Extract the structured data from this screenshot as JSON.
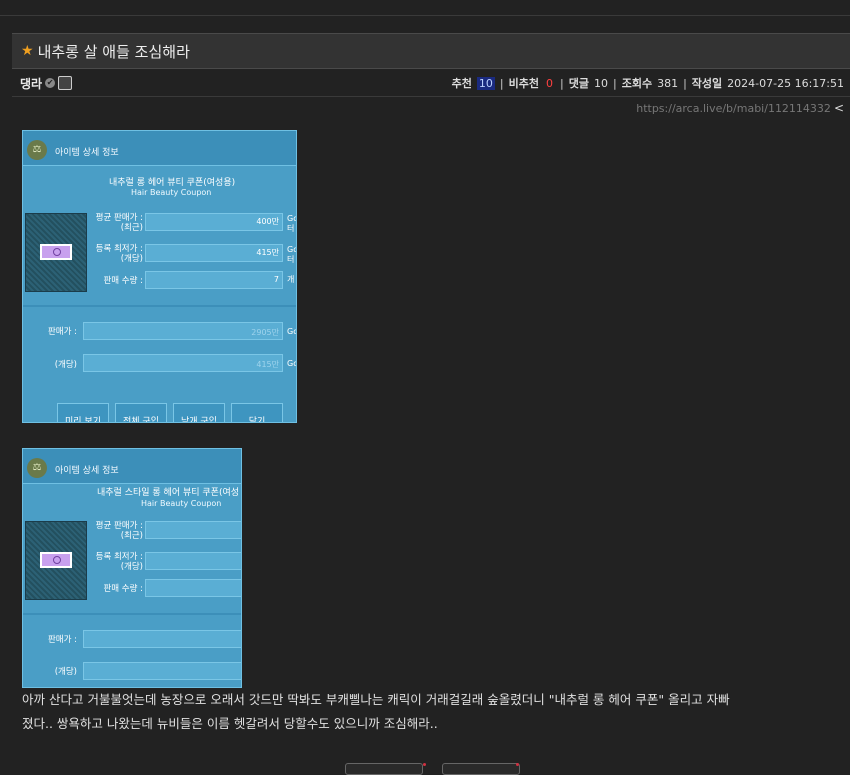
{
  "post": {
    "title": "내추롱 살 애들 조심해라",
    "author": "댕라",
    "stats": {
      "upvote_label": "추천",
      "upvote_count": "10",
      "downvote_label": "비추천",
      "downvote_count": "0",
      "comment_label": "댓글",
      "comment_count": "10",
      "view_label": "조회수",
      "view_count": "381",
      "date_label": "작성일",
      "date": "2024-07-25 16:17:51"
    },
    "url": "https://arca.live/b/mabi/112114332",
    "body_line1": "아까 산다고 거불불엇는데 농장으로 오래서 갓드만 딱봐도 부캐삘나는 캐릭이 거래걸길래 숲올렸더니 \"내추럴 롱 헤어 쿠폰\" 올리고 자빠",
    "body_line2": "졌다.. 쌍욕하고 나왔는데 뉴비들은 이름 헷갈려서 당할수도 있으니까 조심해라.."
  },
  "dialog1": {
    "title": "아이템 상세 정보",
    "item_name": "내추럴 롱 헤어 뷰티 쿠폰(여성용)",
    "item_eng": "Hair Beauty Coupon",
    "avg_label": "평균 판매가 :\n(최근)",
    "avg_value": "400만",
    "avg_unit": "Go\n터",
    "min_label": "등록 최저가 :\n(개당)",
    "min_value": "415만",
    "min_unit": "Go\n터",
    "qty_label": "판매 수량 :",
    "qty_value": "7",
    "qty_unit": "개",
    "price_label": "판매가 :",
    "price_value": "2905만",
    "price_unit": "Go",
    "each_label": "(개당)",
    "each_value": "415만",
    "each_unit": "Go",
    "buttons": [
      "미리 보기",
      "전체 구입",
      "낱개 구입",
      "닫기"
    ]
  },
  "dialog2": {
    "title": "아이템 상세 정보",
    "item_name": "내추럴 스타일 롱 헤어 뷰티 쿠폰(여성",
    "item_eng": "Hair Beauty Coupon",
    "avg_label": "평균 판매가 :\n(최근)",
    "min_label": "등록 최저가 :\n(개당)",
    "qty_label": "판매 수량 :",
    "price_label": "판매가 :",
    "each_label": "(개당)"
  },
  "colors": {
    "background": "#222222",
    "star": "#f0a020",
    "upvote_bg": "#1a2a80",
    "downvote": "#ff4040",
    "dialog_bg": "#4a9ec6"
  },
  "icons": {
    "title": "star-icon",
    "author_badge": "verified-icon",
    "author_extra": "user-icon",
    "url": "share-icon"
  }
}
